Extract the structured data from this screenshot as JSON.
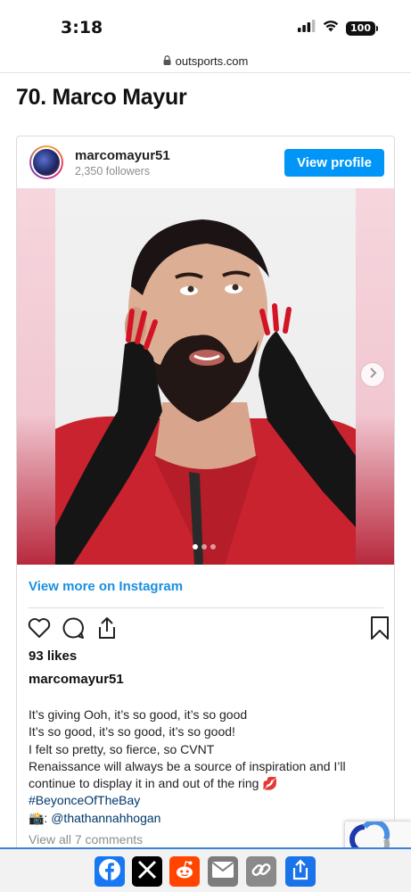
{
  "status_bar": {
    "time": "3:18",
    "battery": "100"
  },
  "browser": {
    "url": "outsports.com"
  },
  "article": {
    "heading": "70. Marco Mayur"
  },
  "instagram": {
    "username": "marcomayur51",
    "followers": "2,350 followers",
    "view_profile_label": "View profile",
    "view_more_label": "View more on Instagram",
    "likes": "93 likes",
    "caption_user": "marcomayur51",
    "caption_lines": [
      "It’s giving Ooh, it’s so good, it’s so good",
      "It’s so good, it’s so good, it’s so good!",
      "I felt so pretty, so fierce, so CVNT",
      "Renaissance will always be a source of inspiration and I’ll",
      "continue to display it in and out of the ring 💋"
    ],
    "hashtag": "#BeyonceOfTheBay",
    "credit_prefix": "📸: ",
    "credit_handle": "@thathannahhogan",
    "view_comments_label": "View all 7 comments",
    "carousel": {
      "slide_count": 3,
      "active_index": 0
    }
  },
  "colors": {
    "instagram_blue": "#0095f6",
    "link_blue": "#1a8fe0",
    "share_bar_accent": "#3b83d6"
  },
  "share_bar": {
    "buttons": [
      "facebook-icon",
      "x-icon",
      "reddit-icon",
      "email-icon",
      "link-icon",
      "share-icon"
    ]
  }
}
